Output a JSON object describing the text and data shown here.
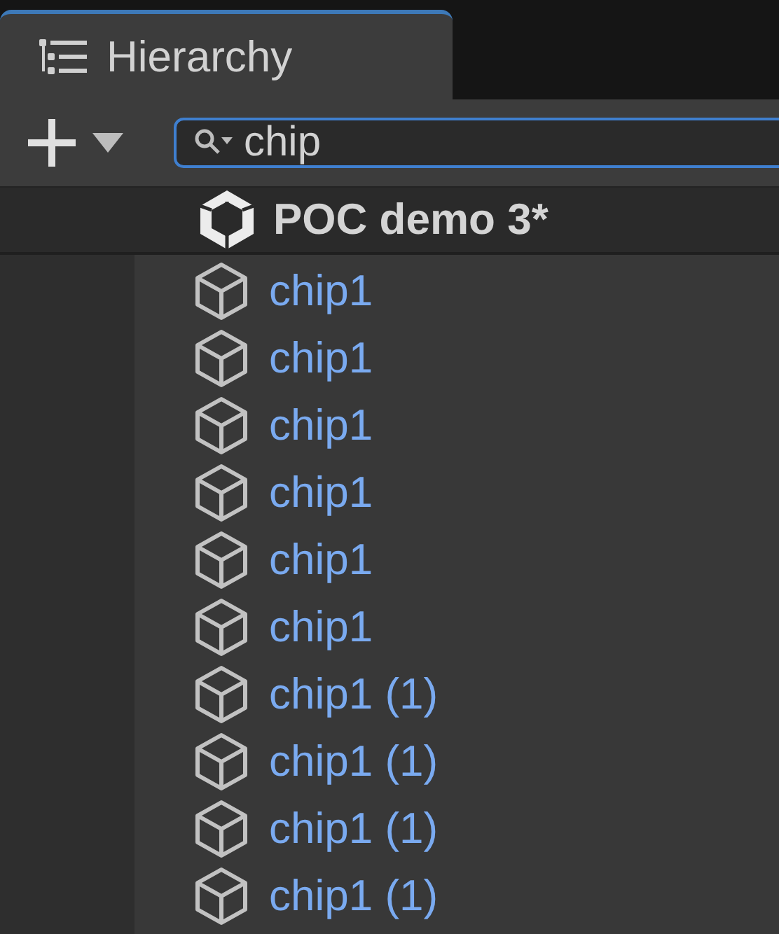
{
  "tab": {
    "title": "Hierarchy",
    "selected": true
  },
  "toolbar": {
    "search": {
      "value": "chip"
    }
  },
  "scene": {
    "name": "POC demo 3*"
  },
  "objects": [
    {
      "name": "chip1"
    },
    {
      "name": "chip1"
    },
    {
      "name": "chip1"
    },
    {
      "name": "chip1"
    },
    {
      "name": "chip1"
    },
    {
      "name": "chip1"
    },
    {
      "name": "chip1 (1)"
    },
    {
      "name": "chip1 (1)"
    },
    {
      "name": "chip1 (1)"
    },
    {
      "name": "chip1 (1)"
    }
  ]
}
